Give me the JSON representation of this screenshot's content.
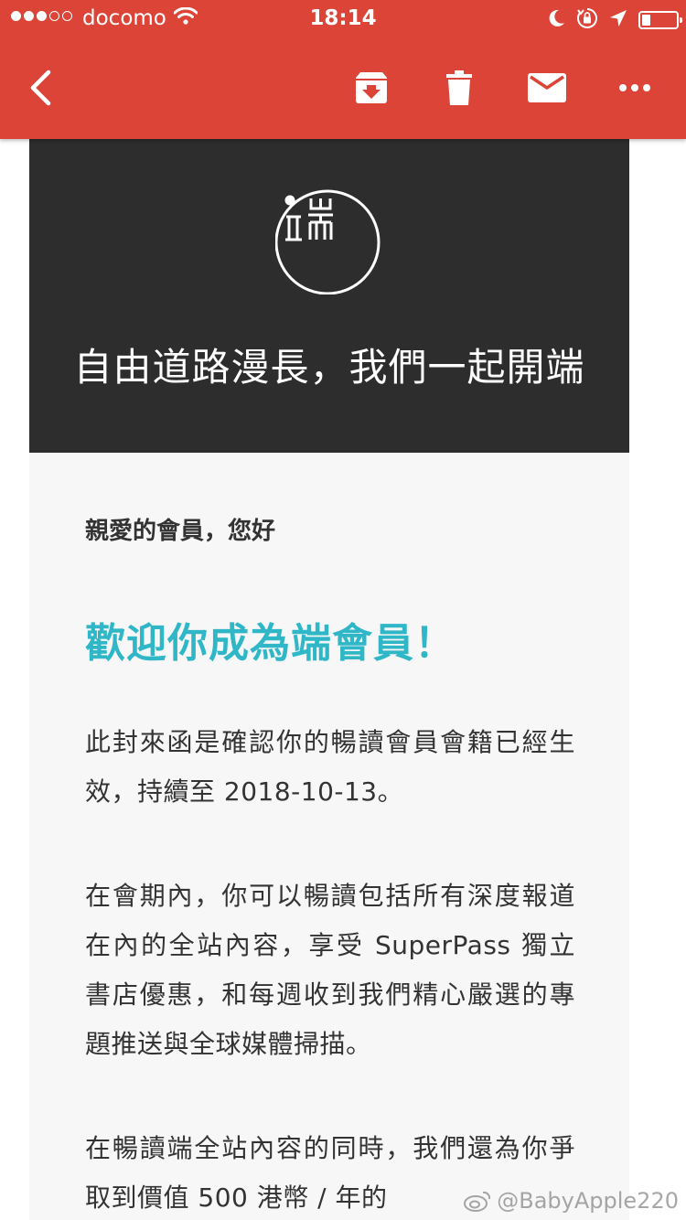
{
  "status_bar": {
    "carrier": "docomo",
    "time": "18:14",
    "signal_bars_filled": 3,
    "signal_bars_total": 5,
    "battery_level": 0.25
  },
  "toolbar": {
    "back_icon": "chevron-left-icon",
    "archive_icon": "archive-icon",
    "delete_icon": "trash-icon",
    "mark_unread_icon": "mail-icon",
    "more_icon": "more-horizontal-icon"
  },
  "email": {
    "hero": {
      "tagline": "自由道路漫長，我們一起開端"
    },
    "greeting": "親愛的會員，您好",
    "welcome_heading": "歡迎你成為端會員！",
    "paragraphs": [
      "此封來函是確認你的暢讀會員會籍已經生效，持續至 2018-10-13。",
      "在會期內，你可以暢讀包括所有深度報道在內的全站內容，享受 SuperPass 獨立書店優惠，和每週收到我們精心嚴選的專題推送與全球媒體掃描。",
      "在暢讀端全站內容的同時，我們還為你爭取到價值 500 港幣 / 年的"
    ]
  },
  "watermark": {
    "text": "@BabyApple220"
  },
  "colors": {
    "header_red": "#db4437",
    "hero_dark": "#2d2d2d",
    "accent_teal": "#2fb7c8",
    "body_bg": "#f7f7f7",
    "text_dark": "#333333"
  }
}
